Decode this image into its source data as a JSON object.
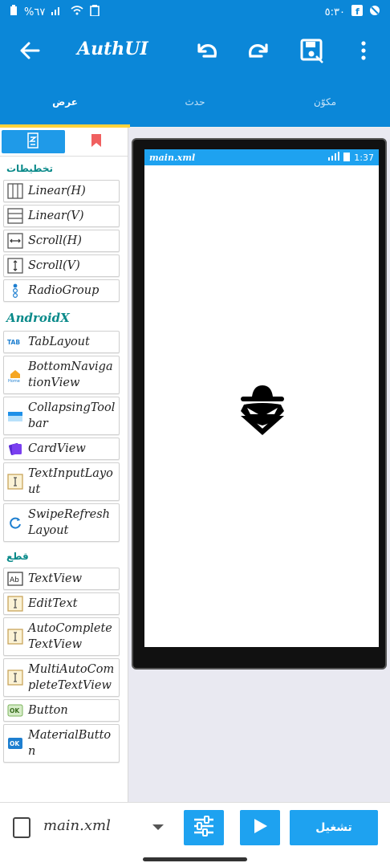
{
  "status_bar": {
    "battery": "%٦٧",
    "time": "٥:٣٠"
  },
  "app": {
    "title": "AuthUI"
  },
  "tabs": [
    {
      "label": "عرض"
    },
    {
      "label": "حدث"
    },
    {
      "label": "مكوّن"
    }
  ],
  "palette": {
    "layouts_header": "تخطيطات",
    "layouts": [
      {
        "label": "Linear(H)",
        "icon": "linear-h-icon"
      },
      {
        "label": "Linear(V)",
        "icon": "linear-v-icon"
      },
      {
        "label": "Scroll(H)",
        "icon": "scroll-h-icon"
      },
      {
        "label": "Scroll(V)",
        "icon": "scroll-v-icon"
      },
      {
        "label": "RadioGroup",
        "icon": "radiogroup-icon"
      }
    ],
    "androidx_header": "AndroidX",
    "androidx": [
      {
        "label": "TabLayout",
        "icon": "tablayout-icon"
      },
      {
        "label": "BottomNavigationView",
        "icon": "bottom-navigation-icon"
      },
      {
        "label": "CollapsingToolbar",
        "icon": "collapsing-toolbar-icon"
      },
      {
        "label": "CardView",
        "icon": "cardview-icon"
      },
      {
        "label": "TextInputLayout",
        "icon": "textinputlayout-icon"
      },
      {
        "label": "SwipeRefreshLayout",
        "icon": "swiperefresh-icon"
      }
    ],
    "widgets_header": "قطع",
    "widgets": [
      {
        "label": "TextView",
        "icon": "textview-icon"
      },
      {
        "label": "EditText",
        "icon": "edittext-icon"
      },
      {
        "label": "AutoCompleteTextView",
        "icon": "autocomplete-icon"
      },
      {
        "label": "MultiAutoCompleteTextView",
        "icon": "multiautocomplete-icon"
      },
      {
        "label": "Button",
        "icon": "button-icon"
      },
      {
        "label": "MaterialButton",
        "icon": "materialbutton-icon"
      }
    ]
  },
  "preview": {
    "file_name": "main.xml",
    "time": "1:37"
  },
  "bottom_bar": {
    "file_name": "main.xml",
    "run_label": "تشغيل"
  },
  "colors": {
    "primary": "#0b87d8",
    "accent": "#1ea2f0",
    "tab_indicator": "#ffd33d",
    "section_text": "#0a8a8a"
  }
}
